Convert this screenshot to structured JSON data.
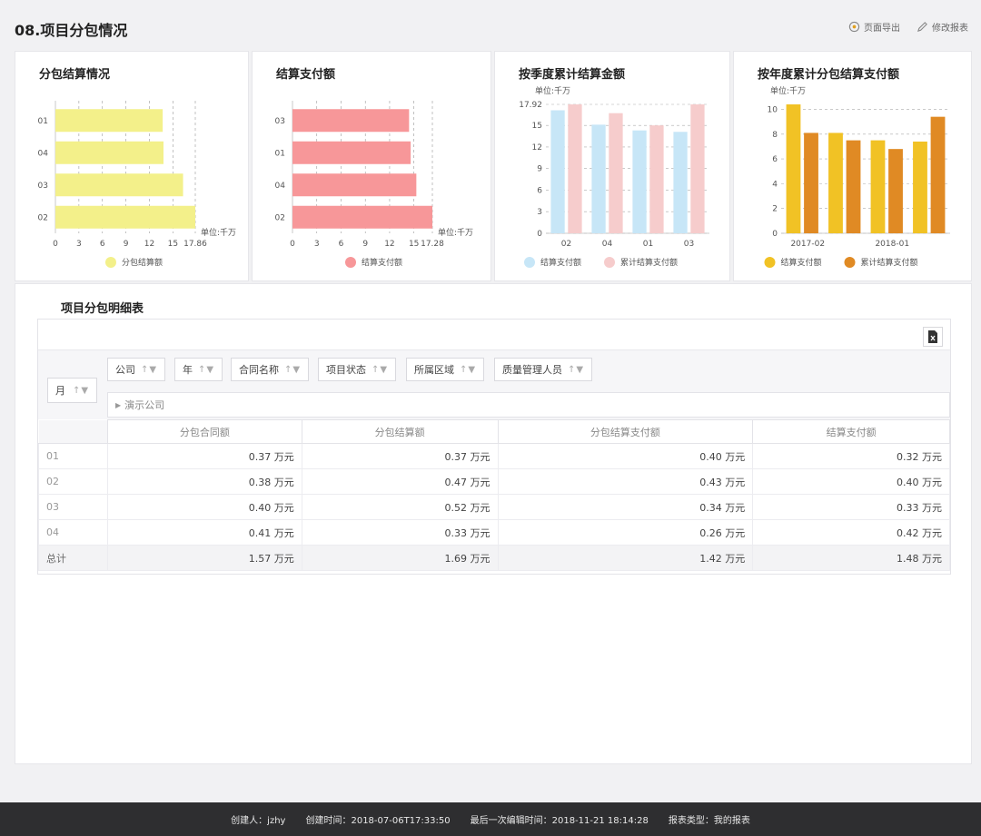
{
  "header": {
    "title": "08.项目分包情况",
    "export_label": "页面导出",
    "edit_label": "修改报表"
  },
  "cards": [
    {
      "title": "分包结算情况"
    },
    {
      "title": "结算支付额"
    },
    {
      "title": "按季度累计结算金额"
    },
    {
      "title": "按年度累计分包结算支付额"
    }
  ],
  "colors": {
    "yellow_bar": "#f3f08a",
    "pink_bar": "#f79799",
    "light_blue": "#c7e6f7",
    "light_pink": "#f6cccc",
    "gold": "#f1c225",
    "orange": "#e08a24"
  },
  "chart_data": [
    {
      "type": "bar",
      "orientation": "horizontal",
      "categories": [
        "01",
        "04",
        "03",
        "02"
      ],
      "series": [
        {
          "name": "分包结算额",
          "values": [
            13.7,
            13.8,
            16.3,
            17.86
          ]
        }
      ],
      "xlim": [
        0,
        17.86
      ],
      "xticks": [
        "0",
        "3",
        "6",
        "9",
        "12",
        "15",
        "17.86"
      ],
      "unit_label": "单位:千万",
      "legend": "bottom"
    },
    {
      "type": "bar",
      "orientation": "horizontal",
      "categories": [
        "03",
        "01",
        "04",
        "02"
      ],
      "series": [
        {
          "name": "结算支付额",
          "values": [
            14.4,
            14.6,
            15.3,
            17.28
          ]
        }
      ],
      "xlim": [
        0,
        17.28
      ],
      "xticks": [
        "0",
        "3",
        "6",
        "9",
        "12",
        "15",
        "17.28"
      ],
      "unit_label": "单位:千万",
      "legend": "bottom"
    },
    {
      "type": "bar",
      "categories": [
        "02",
        "04",
        "01",
        "03"
      ],
      "series": [
        {
          "name": "结算支付额",
          "values": [
            17.1,
            15.1,
            14.3,
            14.1
          ]
        },
        {
          "name": "累计结算支付额",
          "values": [
            17.92,
            16.7,
            15.0,
            17.92
          ]
        }
      ],
      "ylim": [
        0,
        17.92
      ],
      "yticks": [
        "0",
        "3",
        "6",
        "9",
        "12",
        "15",
        "17.92"
      ],
      "unit_label": "单位:千万",
      "legend": "bottom"
    },
    {
      "type": "bar",
      "categories": [
        "2017-02",
        "",
        "2018-01",
        ""
      ],
      "xtick_labels": [
        "2017-02",
        "2018-01"
      ],
      "series": [
        {
          "name": "结算支付额",
          "values": [
            10.4,
            8.1,
            7.5,
            7.4
          ]
        },
        {
          "name": "累计结算支付额",
          "values": [
            8.1,
            7.5,
            6.8,
            9.4
          ]
        }
      ],
      "ylim": [
        0,
        10.4
      ],
      "yticks": [
        "0",
        "2",
        "4",
        "6",
        "8",
        "10"
      ],
      "unit_label": "单位:千万",
      "legend": "bottom"
    }
  ],
  "detail": {
    "title": "项目分包明细表",
    "fields": [
      "公司",
      "年",
      "合同名称",
      "项目状态",
      "所属区域",
      "质量管理人员"
    ],
    "row_field": "月",
    "company": "演示公司",
    "columns": [
      "分包合同额",
      "分包结算额",
      "分包结算支付额",
      "结算支付额"
    ],
    "rows": [
      {
        "label": "01",
        "cells": [
          "0.37 万元",
          "0.37 万元",
          "0.40 万元",
          "0.32 万元"
        ]
      },
      {
        "label": "02",
        "cells": [
          "0.38 万元",
          "0.47 万元",
          "0.43 万元",
          "0.40 万元"
        ]
      },
      {
        "label": "03",
        "cells": [
          "0.40 万元",
          "0.52 万元",
          "0.34 万元",
          "0.33 万元"
        ]
      },
      {
        "label": "04",
        "cells": [
          "0.41 万元",
          "0.33 万元",
          "0.26 万元",
          "0.42 万元"
        ]
      }
    ],
    "total": {
      "label": "总计",
      "cells": [
        "1.57 万元",
        "1.69 万元",
        "1.42 万元",
        "1.48 万元"
      ]
    }
  },
  "footer": {
    "creator": "创建人：jzhy",
    "created": "创建时间：2018-07-06T17:33:50",
    "edited": "最后一次编辑时间：2018-11-21 18:14:28",
    "type": "报表类型：我的报表"
  }
}
